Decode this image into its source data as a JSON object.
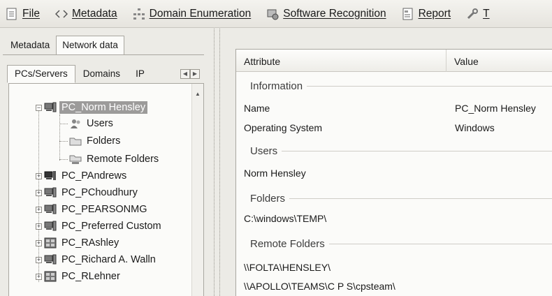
{
  "menubar": {
    "items": [
      {
        "label": "File",
        "icon": "file-icon"
      },
      {
        "label": "Metadata",
        "icon": "metadata-icon"
      },
      {
        "label": "Domain Enumeration",
        "icon": "domain-enumeration-icon"
      },
      {
        "label": "Software Recognition",
        "icon": "software-recognition-icon"
      },
      {
        "label": "Report",
        "icon": "report-icon"
      }
    ],
    "overflow_text": "T"
  },
  "left": {
    "tabs": [
      "Metadata",
      "Network data"
    ],
    "selected_tab": "Network data",
    "subtabs": [
      "PCs/Servers",
      "Domains",
      "IP"
    ],
    "selected_subtab": "PCs/Servers",
    "tree": {
      "selected_node": {
        "label": "PC_Norm Hensley"
      },
      "children": [
        {
          "label": "Users"
        },
        {
          "label": "Folders"
        },
        {
          "label": "Remote Folders"
        }
      ],
      "siblings": [
        {
          "label": "PC_PAndrews"
        },
        {
          "label": "PC_PChoudhury"
        },
        {
          "label": "PC_PEARSONMG"
        },
        {
          "label": "PC_Preferred Custom"
        },
        {
          "label": "PC_RAshley"
        },
        {
          "label": "PC_Richard A. Walln"
        },
        {
          "label": "PC_RLehner"
        }
      ]
    }
  },
  "right": {
    "columns": {
      "attribute": "Attribute",
      "value": "Value"
    },
    "groups": {
      "information": "Information",
      "users": "Users",
      "folders": "Folders",
      "remote_folders": "Remote Folders"
    },
    "rows": {
      "name": {
        "attr": "Name",
        "value": "PC_Norm Hensley"
      },
      "os": {
        "attr": "Operating System",
        "value": "Windows"
      },
      "user": "Norm Hensley",
      "folder": "C:\\windows\\TEMP\\",
      "remote1": "\\\\FOLTA\\HENSLEY\\",
      "remote2": "\\\\APOLLO\\TEAMS\\C P S\\cpsteam\\"
    }
  }
}
